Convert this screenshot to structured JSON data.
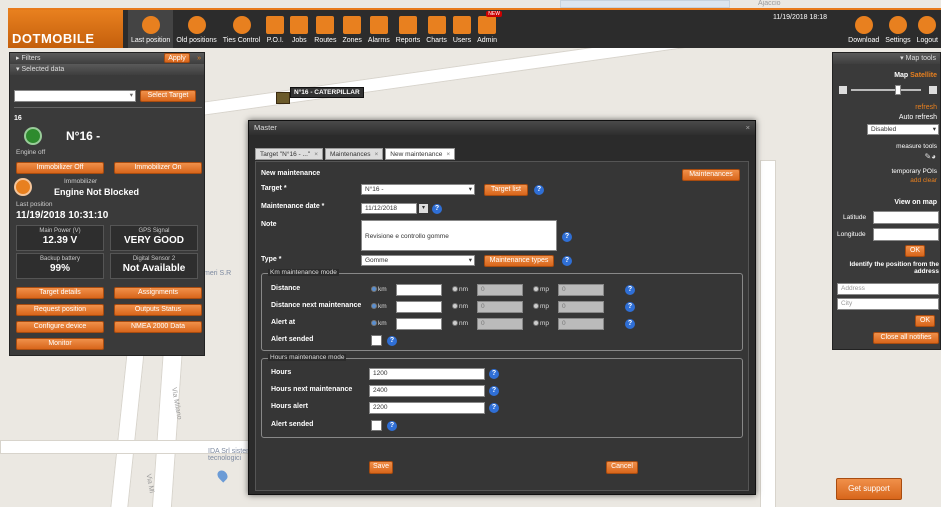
{
  "app": {
    "logo": "DOTMOBILE",
    "datetime": "11/19/2018 18:18"
  },
  "nav": [
    {
      "label": "Last position",
      "icon": "location-icon"
    },
    {
      "label": "Old positions",
      "icon": "history-icon"
    },
    {
      "label": "Ties Control",
      "icon": "ties-icon"
    },
    {
      "label": "P.O.I.",
      "icon": "flag-icon"
    },
    {
      "label": "Jobs",
      "icon": "briefcase-icon"
    },
    {
      "label": "Routes",
      "icon": "route-flag-icon"
    },
    {
      "label": "Zones",
      "icon": "zones-icon"
    },
    {
      "label": "Alarms",
      "icon": "alarm-icon"
    },
    {
      "label": "Reports",
      "icon": "report-icon"
    },
    {
      "label": "Charts",
      "icon": "chart-icon"
    },
    {
      "label": "Users",
      "icon": "users-icon"
    },
    {
      "label": "Admin",
      "icon": "admin-icon",
      "badge": "NEW"
    }
  ],
  "rnav": [
    {
      "label": "Download",
      "icon": "download-icon"
    },
    {
      "label": "Settings",
      "icon": "gear-icon"
    },
    {
      "label": "Logout",
      "icon": "power-icon"
    }
  ],
  "left": {
    "filters": "Filters",
    "apply": "Apply",
    "selected_data": "Selected data",
    "select_target": "Select Target",
    "count": "16",
    "vehicle": "N°16 -",
    "engine": "Engine off",
    "immob_off": "Immobilizer Off",
    "immob_on": "Immobilizer On",
    "immob_title": "Immobilizer",
    "immob_status": "Engine Not Blocked",
    "lastpos_label": "Last position",
    "lastpos": "11/19/2018 10:31:10",
    "cells": [
      {
        "label": "Main Power (V)",
        "value": "12.39 V"
      },
      {
        "label": "GPS Signal",
        "value": "VERY GOOD"
      },
      {
        "label": "Backup battery",
        "value": "99%"
      },
      {
        "label": "Digital Sensor 2",
        "value": "Not Available"
      }
    ],
    "buttons": [
      "Target details",
      "Assignments",
      "Request position",
      "Outputs Status",
      "Configure device",
      "NMEA 2000 Data",
      "Monitor"
    ]
  },
  "maplabel": "N°16 - CATERPILLAR",
  "maptext": {
    "street1": "Via Milano",
    "street2": "Via Mi",
    "company": "IDA Srl sistemi tecnologici",
    "s2": "meri S.R",
    "top": "Ajaccio"
  },
  "right": {
    "title": "Map tools",
    "map": "Map",
    "satellite": "Satellite",
    "refresh": "refresh",
    "auto_refresh": "Auto refresh",
    "disabled": "Disabled",
    "measure": "measure tools",
    "temp_pois": "temporary POIs",
    "add_clear": "add clear",
    "view_on_map": "View on map",
    "latitude": "Latitude",
    "longitude": "Longitude",
    "ok": "OK",
    "identify": "Identify the position from the address",
    "address_ph": "Address",
    "city_ph": "City",
    "close_notifies": "Close all notifies"
  },
  "modal": {
    "title": "Master",
    "tabs": [
      "Target \"N°16 - ...\"",
      "Maintenances",
      "New maintenance"
    ],
    "heading": "New maintenance",
    "maintenances_btn": "Maintenances",
    "target_label": "Target *",
    "target_value": "N°16 -",
    "target_list": "Target list",
    "date_label": "Maintenance date *",
    "date_value": "11/12/2018",
    "note_label": "Note",
    "note_value": "Revisione e controllo gomme",
    "type_label": "Type *",
    "type_value": "Gomme",
    "types_btn": "Maintenance types",
    "km_legend": "Km maintenance mode",
    "km_rows": [
      "Distance",
      "Distance next maintenance",
      "Alert at"
    ],
    "units": [
      "km",
      "nm",
      "mp"
    ],
    "unit_zero": "0",
    "alert_sended": "Alert sended",
    "hours_legend": "Hours maintenance mode",
    "hours": [
      {
        "label": "Hours",
        "value": "1200"
      },
      {
        "label": "Hours next maintenance",
        "value": "2400"
      },
      {
        "label": "Hours alert",
        "value": "2200"
      }
    ],
    "save": "Save",
    "cancel": "Cancel"
  },
  "support": "Get support"
}
